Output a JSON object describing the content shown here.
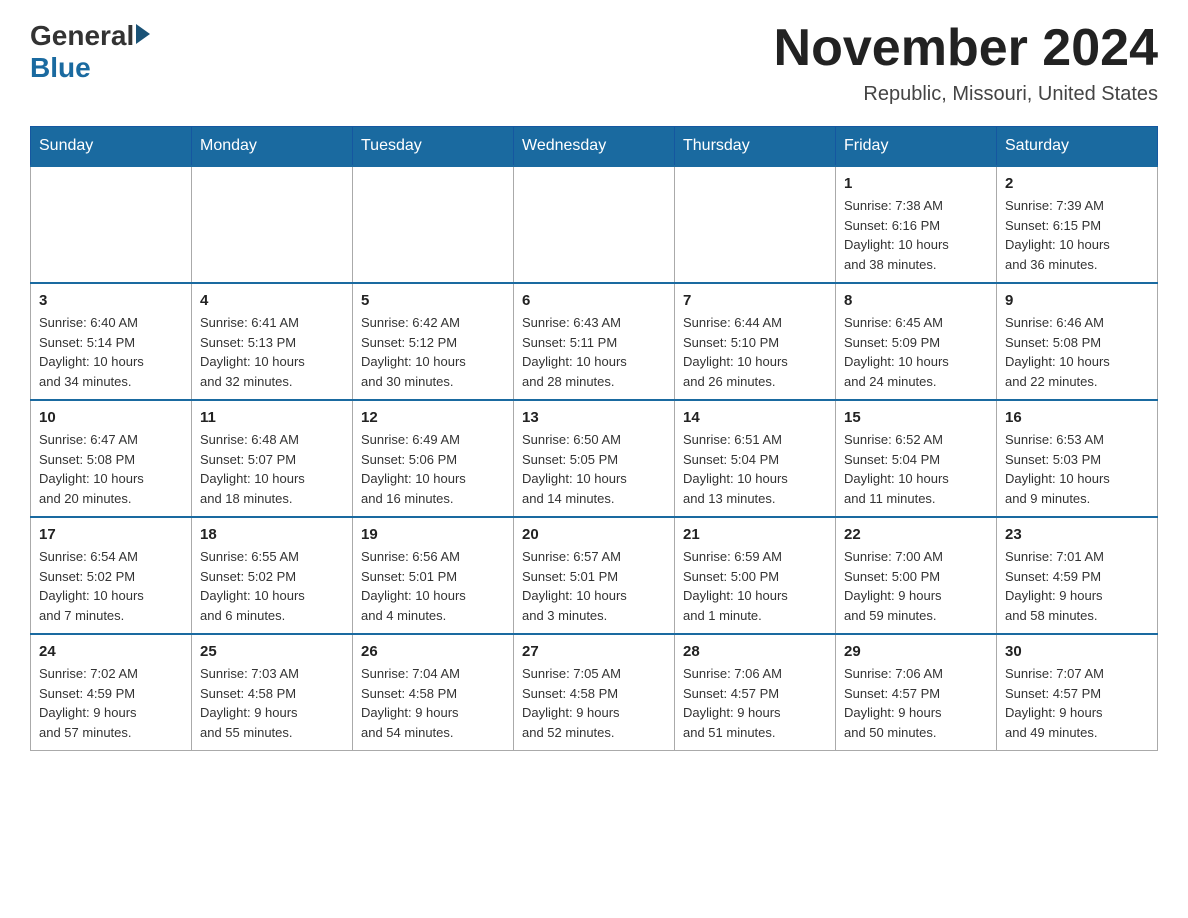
{
  "logo": {
    "general": "General",
    "blue": "Blue"
  },
  "title": "November 2024",
  "location": "Republic, Missouri, United States",
  "days_of_week": [
    "Sunday",
    "Monday",
    "Tuesday",
    "Wednesday",
    "Thursday",
    "Friday",
    "Saturday"
  ],
  "weeks": [
    [
      {
        "day": "",
        "info": ""
      },
      {
        "day": "",
        "info": ""
      },
      {
        "day": "",
        "info": ""
      },
      {
        "day": "",
        "info": ""
      },
      {
        "day": "",
        "info": ""
      },
      {
        "day": "1",
        "info": "Sunrise: 7:38 AM\nSunset: 6:16 PM\nDaylight: 10 hours\nand 38 minutes."
      },
      {
        "day": "2",
        "info": "Sunrise: 7:39 AM\nSunset: 6:15 PM\nDaylight: 10 hours\nand 36 minutes."
      }
    ],
    [
      {
        "day": "3",
        "info": "Sunrise: 6:40 AM\nSunset: 5:14 PM\nDaylight: 10 hours\nand 34 minutes."
      },
      {
        "day": "4",
        "info": "Sunrise: 6:41 AM\nSunset: 5:13 PM\nDaylight: 10 hours\nand 32 minutes."
      },
      {
        "day": "5",
        "info": "Sunrise: 6:42 AM\nSunset: 5:12 PM\nDaylight: 10 hours\nand 30 minutes."
      },
      {
        "day": "6",
        "info": "Sunrise: 6:43 AM\nSunset: 5:11 PM\nDaylight: 10 hours\nand 28 minutes."
      },
      {
        "day": "7",
        "info": "Sunrise: 6:44 AM\nSunset: 5:10 PM\nDaylight: 10 hours\nand 26 minutes."
      },
      {
        "day": "8",
        "info": "Sunrise: 6:45 AM\nSunset: 5:09 PM\nDaylight: 10 hours\nand 24 minutes."
      },
      {
        "day": "9",
        "info": "Sunrise: 6:46 AM\nSunset: 5:08 PM\nDaylight: 10 hours\nand 22 minutes."
      }
    ],
    [
      {
        "day": "10",
        "info": "Sunrise: 6:47 AM\nSunset: 5:08 PM\nDaylight: 10 hours\nand 20 minutes."
      },
      {
        "day": "11",
        "info": "Sunrise: 6:48 AM\nSunset: 5:07 PM\nDaylight: 10 hours\nand 18 minutes."
      },
      {
        "day": "12",
        "info": "Sunrise: 6:49 AM\nSunset: 5:06 PM\nDaylight: 10 hours\nand 16 minutes."
      },
      {
        "day": "13",
        "info": "Sunrise: 6:50 AM\nSunset: 5:05 PM\nDaylight: 10 hours\nand 14 minutes."
      },
      {
        "day": "14",
        "info": "Sunrise: 6:51 AM\nSunset: 5:04 PM\nDaylight: 10 hours\nand 13 minutes."
      },
      {
        "day": "15",
        "info": "Sunrise: 6:52 AM\nSunset: 5:04 PM\nDaylight: 10 hours\nand 11 minutes."
      },
      {
        "day": "16",
        "info": "Sunrise: 6:53 AM\nSunset: 5:03 PM\nDaylight: 10 hours\nand 9 minutes."
      }
    ],
    [
      {
        "day": "17",
        "info": "Sunrise: 6:54 AM\nSunset: 5:02 PM\nDaylight: 10 hours\nand 7 minutes."
      },
      {
        "day": "18",
        "info": "Sunrise: 6:55 AM\nSunset: 5:02 PM\nDaylight: 10 hours\nand 6 minutes."
      },
      {
        "day": "19",
        "info": "Sunrise: 6:56 AM\nSunset: 5:01 PM\nDaylight: 10 hours\nand 4 minutes."
      },
      {
        "day": "20",
        "info": "Sunrise: 6:57 AM\nSunset: 5:01 PM\nDaylight: 10 hours\nand 3 minutes."
      },
      {
        "day": "21",
        "info": "Sunrise: 6:59 AM\nSunset: 5:00 PM\nDaylight: 10 hours\nand 1 minute."
      },
      {
        "day": "22",
        "info": "Sunrise: 7:00 AM\nSunset: 5:00 PM\nDaylight: 9 hours\nand 59 minutes."
      },
      {
        "day": "23",
        "info": "Sunrise: 7:01 AM\nSunset: 4:59 PM\nDaylight: 9 hours\nand 58 minutes."
      }
    ],
    [
      {
        "day": "24",
        "info": "Sunrise: 7:02 AM\nSunset: 4:59 PM\nDaylight: 9 hours\nand 57 minutes."
      },
      {
        "day": "25",
        "info": "Sunrise: 7:03 AM\nSunset: 4:58 PM\nDaylight: 9 hours\nand 55 minutes."
      },
      {
        "day": "26",
        "info": "Sunrise: 7:04 AM\nSunset: 4:58 PM\nDaylight: 9 hours\nand 54 minutes."
      },
      {
        "day": "27",
        "info": "Sunrise: 7:05 AM\nSunset: 4:58 PM\nDaylight: 9 hours\nand 52 minutes."
      },
      {
        "day": "28",
        "info": "Sunrise: 7:06 AM\nSunset: 4:57 PM\nDaylight: 9 hours\nand 51 minutes."
      },
      {
        "day": "29",
        "info": "Sunrise: 7:06 AM\nSunset: 4:57 PM\nDaylight: 9 hours\nand 50 minutes."
      },
      {
        "day": "30",
        "info": "Sunrise: 7:07 AM\nSunset: 4:57 PM\nDaylight: 9 hours\nand 49 minutes."
      }
    ]
  ]
}
